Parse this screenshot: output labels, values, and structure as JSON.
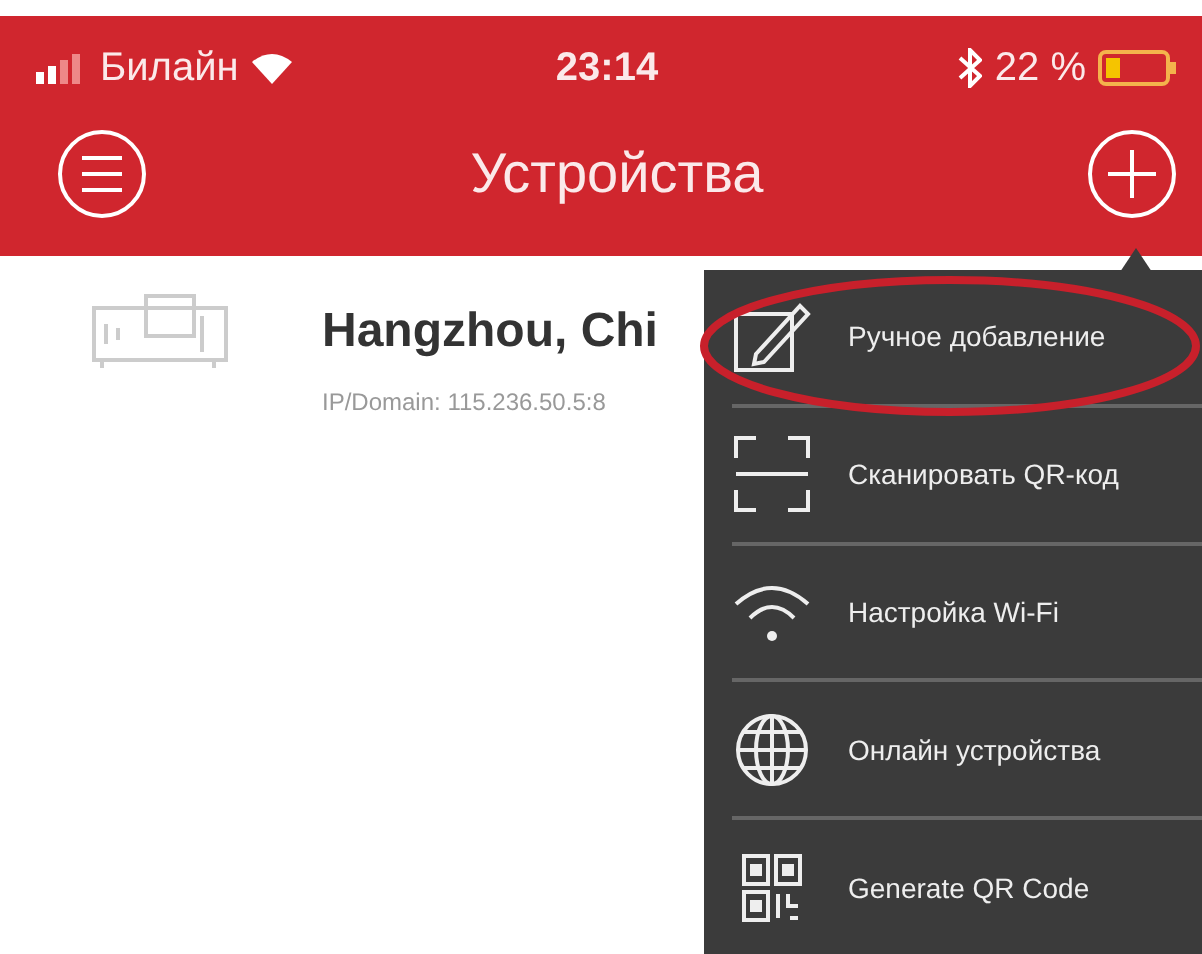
{
  "status_bar": {
    "carrier": "Билайн",
    "time": "23:14",
    "battery": "22 %"
  },
  "header": {
    "title": "Устройства"
  },
  "devices": [
    {
      "name": "Hangzhou, Chi",
      "address": "IP/Domain: 115.236.50.5:8"
    }
  ],
  "menu": {
    "items": [
      {
        "kind": "edit",
        "label": "Ручное добавление",
        "highlighted": true
      },
      {
        "kind": "scan",
        "label": "Сканировать QR-код",
        "highlighted": false
      },
      {
        "kind": "wifi",
        "label": "Настройка  Wi-Fi",
        "highlighted": false
      },
      {
        "kind": "globe",
        "label": "Онлайн устройства",
        "highlighted": false
      },
      {
        "kind": "qr",
        "label": "Generate QR Code",
        "highlighted": false
      }
    ]
  }
}
